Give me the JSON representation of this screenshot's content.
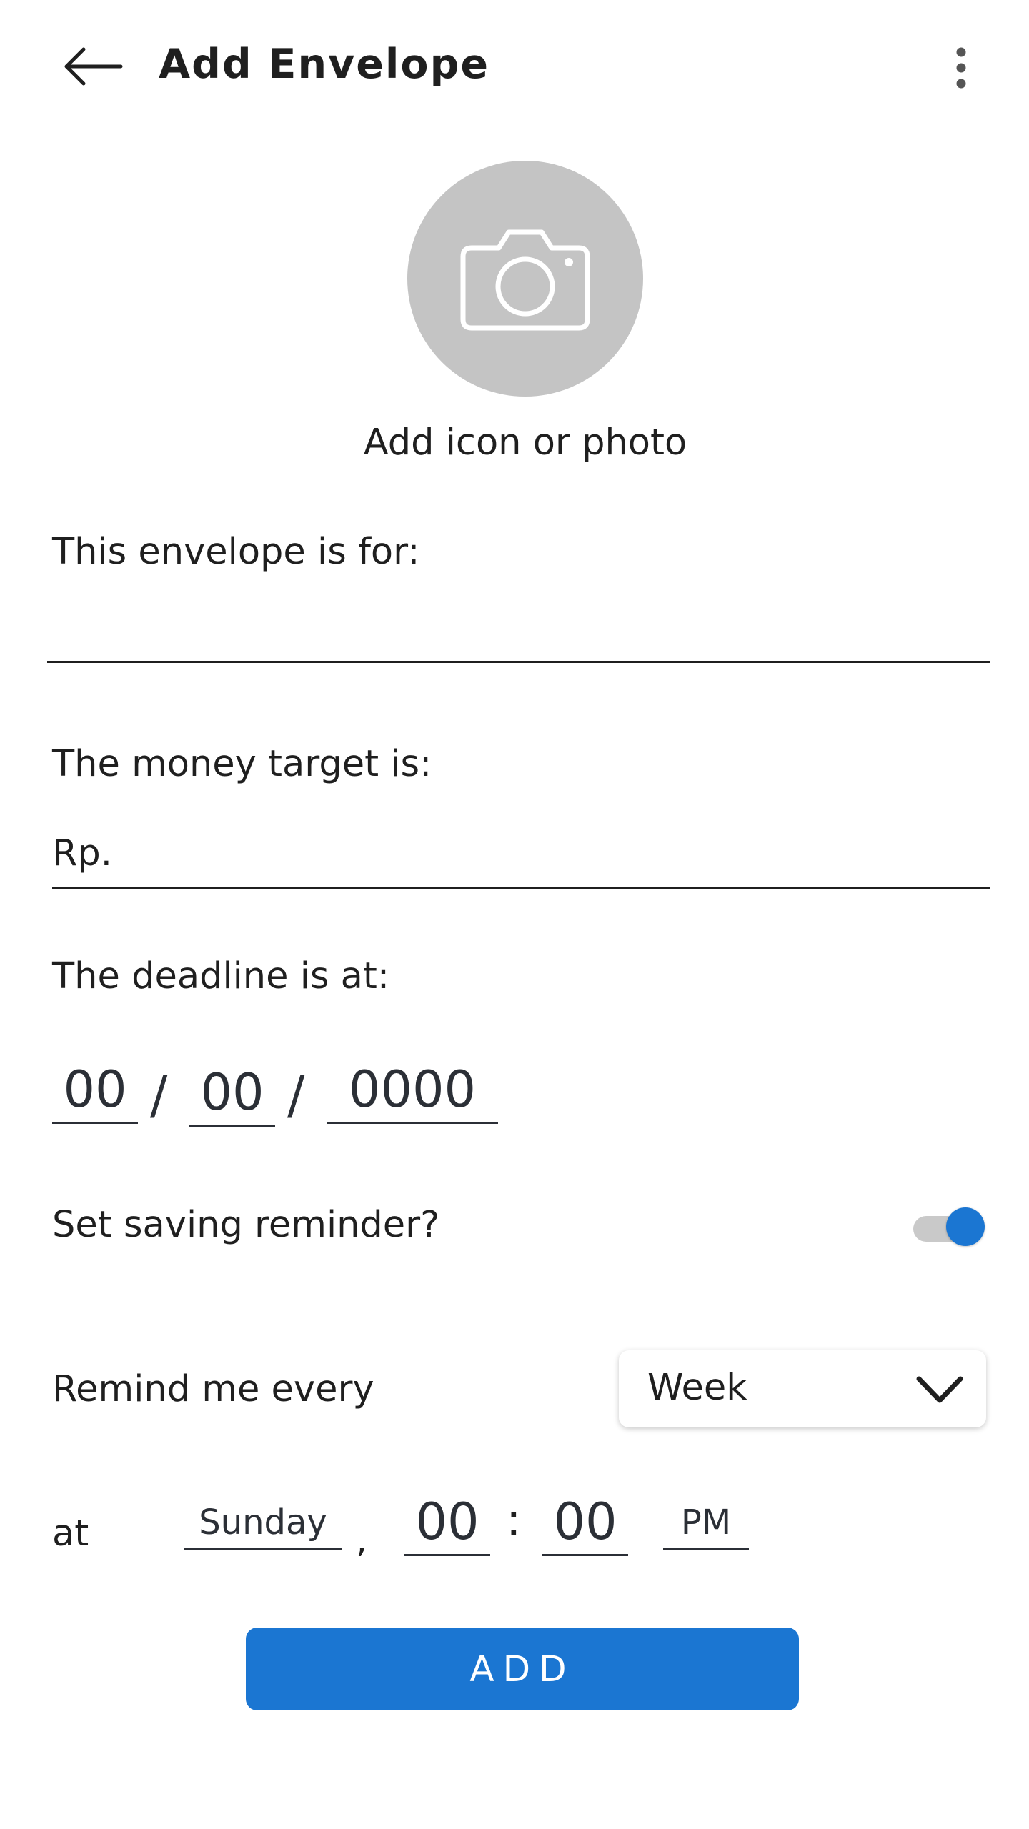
{
  "header": {
    "title": "Add Envelope",
    "back_icon": "arrow-left-icon",
    "menu_icon": "more-vertical-icon"
  },
  "photo": {
    "icon": "camera-icon",
    "caption": "Add icon or photo"
  },
  "envelope": {
    "label": "This envelope is for:",
    "value": "",
    "placeholder": ""
  },
  "target": {
    "label": "The money target is:",
    "prefix": "Rp.",
    "value": ""
  },
  "deadline": {
    "label": "The deadline is at:",
    "day": "00",
    "month": "00",
    "year": "0000",
    "separator": "/"
  },
  "reminder": {
    "label": "Set saving reminder?",
    "enabled": true
  },
  "remind_every": {
    "label": "Remind me every",
    "selected": "Week",
    "chevron_icon": "chevron-down-icon"
  },
  "remind_at": {
    "label": "at",
    "day": "Sunday",
    "comma": ",",
    "hour": "00",
    "colon": ":",
    "minute": "00",
    "period": "PM"
  },
  "actions": {
    "add_label": "ADD"
  },
  "colors": {
    "primary": "#1b76d2",
    "photo_bg": "#c4c4c4",
    "text": "#1f1f1f",
    "toggle_track": "#c9c9c9"
  }
}
